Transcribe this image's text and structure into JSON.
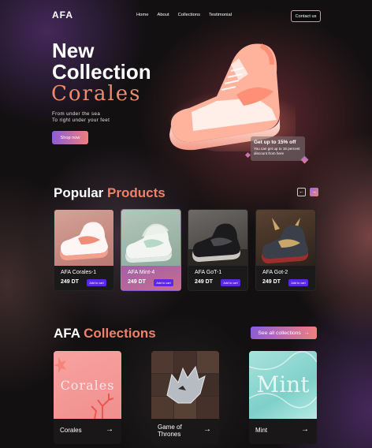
{
  "nav": {
    "logo": "AFA",
    "links": [
      "Home",
      "About",
      "Collections",
      "Testimonial"
    ],
    "contact": "Contact us"
  },
  "hero": {
    "title_line1": "New",
    "title_line2": "Collection",
    "accent": "Corales",
    "subtitle_line1": "From under the sea",
    "subtitle_line2": "To right under your feet",
    "cta": "Shop now",
    "promo_title": "Get up to 15% off",
    "promo_desc_line1": "You can get up to 15 percent",
    "promo_desc_line2": "discount from here"
  },
  "popular": {
    "title_main": "Popular",
    "title_accent": "Products",
    "prev_icon": "←",
    "next_icon": "→",
    "products": [
      {
        "name": "AFA Corales-1",
        "price": "249 DT",
        "cart": "Add to cart"
      },
      {
        "name": "AFA Mint-4",
        "price": "249 DT",
        "cart": "Add to cart"
      },
      {
        "name": "AFA GoT-1",
        "price": "249 DT",
        "cart": "Add to cart"
      },
      {
        "name": "AFA Got-2",
        "price": "249 DT",
        "cart": "Add to cart"
      }
    ]
  },
  "collections": {
    "title_main": "AFA",
    "title_accent": "Collections",
    "see_all": "See all collections",
    "see_all_icon": "→",
    "items": [
      {
        "label": "Corales",
        "watermark": "Corales",
        "arrow": "→"
      },
      {
        "label_line1": "Game of",
        "label_line2": "Thrones",
        "arrow": "→"
      },
      {
        "label": "Mint",
        "watermark": "Mint",
        "arrow": "→"
      }
    ]
  },
  "colors": {
    "accent": "#ef8169",
    "gradient_start": "#8c5cd9",
    "gradient_end": "#ef7e7e",
    "cart_button": "#5b27e6"
  }
}
